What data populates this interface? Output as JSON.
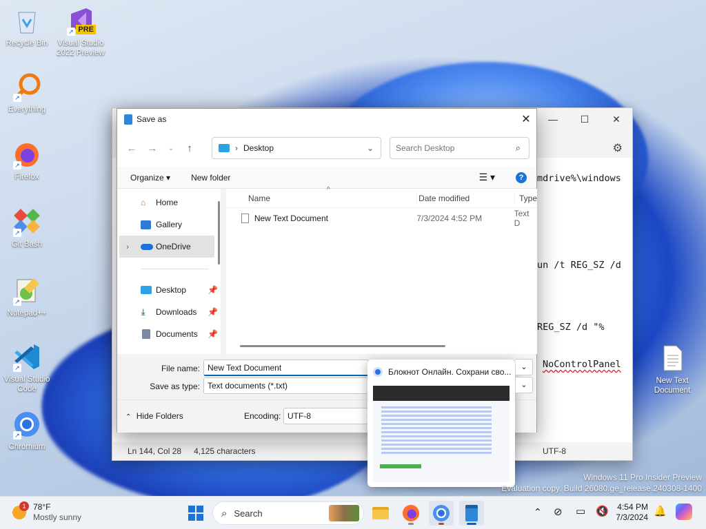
{
  "desktop": {
    "icons": [
      {
        "label": "Recycle Bin"
      },
      {
        "label": "Visual Studio 2022 Preview",
        "badge": "PRE"
      },
      {
        "label": "Everything"
      },
      {
        "label": "Firefox"
      },
      {
        "label": "Git Bash"
      },
      {
        "label": "Notepad++"
      },
      {
        "label": "Visual Studio Code"
      },
      {
        "label": "Chromium"
      },
      {
        "label": "New Text Document"
      }
    ],
    "watermark": {
      "line1": "Windows 11 Pro Insider Preview",
      "line2": "Evaluation copy. Build 26080.ge_release.240308-1400"
    }
  },
  "notepad": {
    "editor_lines": [
      "mdrive%\\windows",
      "un /t REG_SZ /d",
      "REG_SZ /d \"%",
      "NoControlPanel"
    ],
    "status": {
      "position": "Ln 144, Col 28",
      "characters": "4,125 characters",
      "encoding": "UTF-8"
    }
  },
  "dialog": {
    "title": "Save as",
    "address": {
      "location": "Desktop"
    },
    "search": {
      "placeholder": "Search Desktop"
    },
    "commands": {
      "organize": "Organize",
      "new_folder": "New folder"
    },
    "nav_pane": [
      {
        "label": "Home",
        "icon": "home-icon"
      },
      {
        "label": "Gallery",
        "icon": "gallery-icon"
      },
      {
        "label": "OneDrive",
        "icon": "onedrive-icon",
        "selected": true
      },
      {
        "label": "Desktop",
        "icon": "desktop-icon",
        "pinned": true
      },
      {
        "label": "Downloads",
        "icon": "download-icon",
        "pinned": true
      },
      {
        "label": "Documents",
        "icon": "document-icon",
        "pinned": true
      }
    ],
    "columns": [
      "Name",
      "Date modified",
      "Type"
    ],
    "files": [
      {
        "name": "New Text Document",
        "date": "7/3/2024 4:52 PM",
        "type": "Text D"
      }
    ],
    "file_name_label": "File name:",
    "file_name_value": "New Text Document",
    "save_type_label": "Save as type:",
    "save_type_value": "Text documents (*.txt)",
    "hide_folders": "Hide Folders",
    "encoding_label": "Encoding:",
    "encoding_value": "UTF-8"
  },
  "thumbnail": {
    "caption": "Блокнот Онлайн. Сохрани сво..."
  },
  "taskbar": {
    "weather": {
      "temp": "78°F",
      "condition": "Mostly sunny",
      "badge": "1"
    },
    "search_label": "Search",
    "time": "4:54 PM",
    "date": "7/3/2024"
  },
  "colors": {
    "accent": "#0067c0",
    "selection": "#e2e2e2",
    "taskbar": "#eef1f6"
  }
}
